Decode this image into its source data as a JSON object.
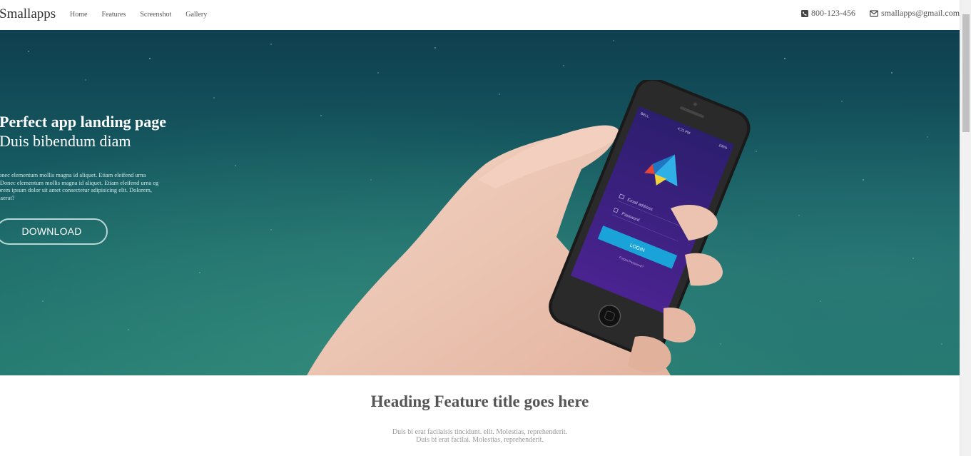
{
  "nav": {
    "brand": "Smallapps",
    "links": [
      "Home",
      "Features",
      "Screenshot",
      "Gallery"
    ],
    "phone": "800-123-456",
    "email": "smallapps@gmail.com",
    "phone_icon": "phone-icon",
    "email_icon": "envelope-icon"
  },
  "hero": {
    "title": "Perfect app landing page",
    "subtitle": "Duis bibendum diam",
    "description_lines": [
      "Donec elementum mollis magna id aliquet. Etiam eleifend urna",
      "egDonec elementum mollis magna id aliquet. Etiam eleifend urna eg",
      "Lorem ipsum dolor sit amet consectetur adipisicing elit. Dolorem,",
      "quaerat?"
    ],
    "download_label": "DOWNLOAD",
    "phone_screen": {
      "status_left": "BELL",
      "status_time": "4:21 PM",
      "status_battery": "100%",
      "email_placeholder": "Email address",
      "password_placeholder": "Password",
      "login_label": "LOGIN",
      "forgot_label": "Forgot Password?"
    }
  },
  "features": {
    "title": "Heading Feature title goes here",
    "desc_line1": "Duis bi erat facilaisis tincidunt. elit. Molestias, reprehenderit.",
    "desc_line2": "Duis bi erat facilai. Molestias, reprehenderit."
  },
  "colors": {
    "hero_dark": "#0f3f4f",
    "hero_light": "#23786f",
    "phone_screen": "#3a1f7a",
    "login_button": "#1aa3d9"
  }
}
